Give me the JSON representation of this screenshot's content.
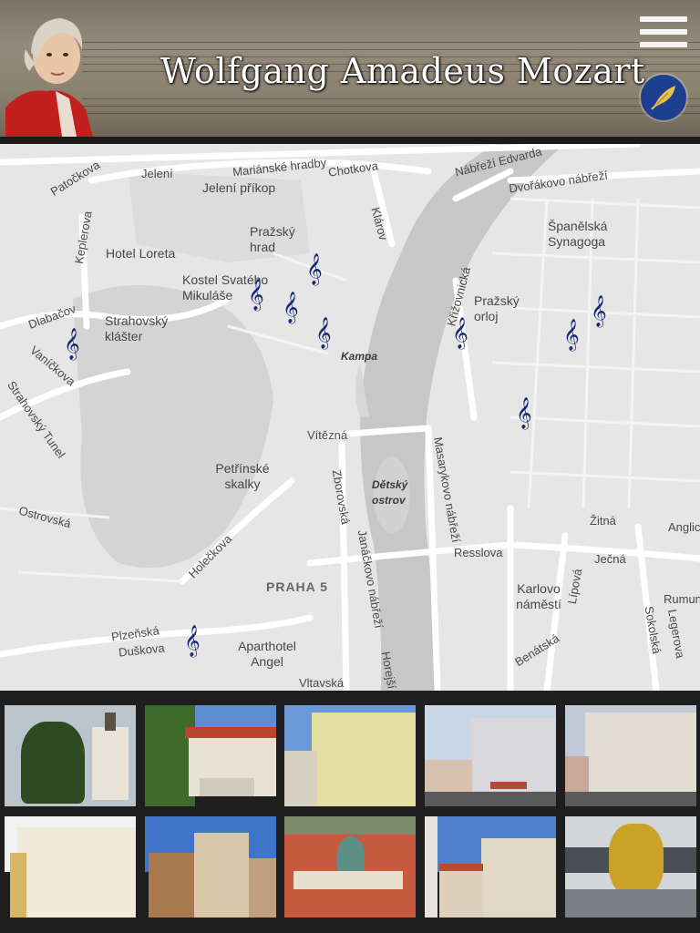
{
  "header": {
    "title": "Wolfgang Amadeus Mozart",
    "menu_icon": "hamburger-menu-icon",
    "quill_icon": "quill-feather-icon",
    "accent": "#1d3f8f"
  },
  "map": {
    "marker_icon": "treble-clef-icon",
    "marker_color": "#1a2a78",
    "streets": [
      "Patočkova",
      "Jelení",
      "Mariánské hradby",
      "Chotkova",
      "Nábřeží Edvarda",
      "Dvořákovo nábřeží",
      "Keplerova",
      "Dlabačov",
      "Vaníčkova",
      "Klárov",
      "Křižovnická",
      "Vítězná",
      "Zborovská",
      "Janáčkovo nábřeží",
      "Masarykovo nábřeží",
      "Holečkova",
      "Resslova",
      "Žitná",
      "Ječná",
      "Lípová",
      "Plzeňská",
      "Duškova",
      "Vltavská",
      "Sokolská",
      "Legerova",
      "Benátská",
      "Horejší",
      "Strahovský Tunel",
      "Ostrovská",
      "Anglická",
      "Rumunská"
    ],
    "places": [
      "Jelení příkop",
      "Pražský hrad",
      "Hotel Loreta",
      "Kostel Svatého Mikuláše",
      "Strahovský klášter",
      "Španělská Synagoga",
      "Pražský orloj",
      "Kampa",
      "Petřínské skalky",
      "Dětský ostrov",
      "PRAHA 5",
      "Karlovo náměstí",
      "Aparthotel Angel"
    ]
  },
  "gallery": {
    "photos": [
      "photo-1",
      "photo-2",
      "photo-3",
      "photo-4",
      "photo-5",
      "photo-6",
      "photo-7",
      "photo-8",
      "photo-9",
      "photo-10"
    ]
  }
}
